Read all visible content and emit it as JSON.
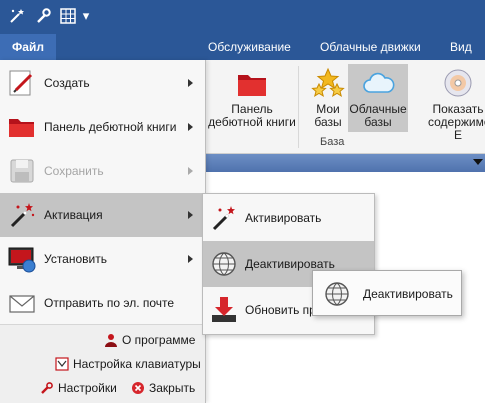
{
  "quick_access": {
    "icons": [
      "magic-wand-stars-icon",
      "wrench-icon",
      "grid-icon",
      "dropdown-arrow-icon"
    ],
    "dropdown_glyph": "▾"
  },
  "ribbon_tabs": {
    "file": "Файл",
    "tabs": [
      "Обслуживание",
      "Облачные движки",
      "Вид"
    ]
  },
  "ribbon": {
    "panel_button": "Панель дебютной книги",
    "my_bases": "Мои базы",
    "cloud_bases": "Облачные базы",
    "show_contents": "Показать содержимое Е",
    "group_label": "База"
  },
  "file_menu": {
    "items": [
      {
        "label": "Создать",
        "icon": "pencil-document-icon",
        "submenu": true
      },
      {
        "label": "Панель дебютной книги",
        "icon": "red-folder-icon",
        "submenu": true
      },
      {
        "label": "Сохранить",
        "icon": "floppy-disk-icon",
        "submenu": true,
        "disabled": true
      },
      {
        "label": "Активация",
        "icon": "magic-wand-icon",
        "submenu": true,
        "highlighted": true
      },
      {
        "label": "Установить",
        "icon": "monitor-install-icon",
        "submenu": true
      },
      {
        "label": "Отправить по эл. почте",
        "icon": "envelope-icon",
        "submenu": false
      }
    ],
    "footer": {
      "about": "О программе",
      "keyboard": "Настройка клавиатуры",
      "settings": "Настройки",
      "close": "Закрыть"
    }
  },
  "activation_submenu": {
    "items": [
      {
        "label": "Активировать",
        "icon": "magic-wand-icon"
      },
      {
        "label": "Деактивировать",
        "icon": "globe-icon",
        "highlighted": true
      },
      {
        "label": "Обновить пр",
        "icon": "red-arrow-down-icon"
      }
    ]
  },
  "tooltip": {
    "label": "Деактивировать",
    "icon": "globe-icon"
  },
  "colors": {
    "title_bar": "#2b5797",
    "file_tab": "#3d6db5",
    "ribbon_bg": "#f4f4f4",
    "menu_bg": "#f7f7f7",
    "highlight": "#c4c4c4",
    "disabled_text": "#a5a5a5"
  }
}
